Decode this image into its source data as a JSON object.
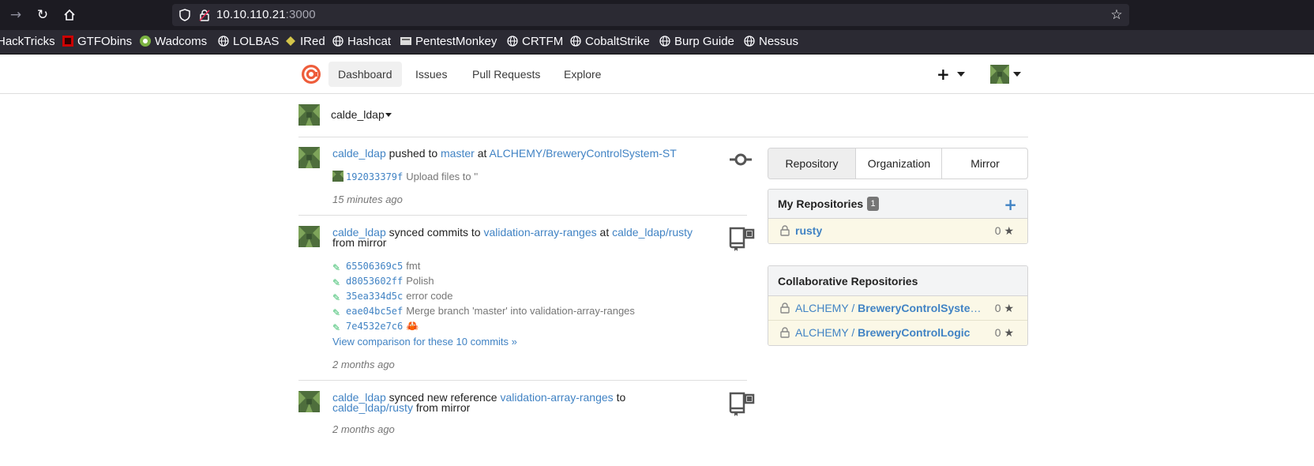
{
  "browser": {
    "url_host": "10.10.110.21",
    "url_port": ":3000",
    "bookmarks": [
      "HackTricks",
      "GTFObins",
      "Wadcoms",
      "LOLBAS",
      "IRed",
      "Hashcat",
      "PentestMonkey",
      "CRTFM",
      "CobaltStrike",
      "Burp Guide",
      "Nessus"
    ]
  },
  "navbar": {
    "items": [
      "Dashboard",
      "Issues",
      "Pull Requests",
      "Explore"
    ],
    "active": "Dashboard",
    "create_icon": "plus-icon",
    "brand_color": "#ee5d3b"
  },
  "context": {
    "user": "calde_ldap"
  },
  "feed": [
    {
      "user": "calde_ldap",
      "action": "pushed to",
      "ref": "master",
      "connector": "at",
      "repo": "ALCHEMY/BreweryControlSystem-ST",
      "suffix": "",
      "icon": "commit-icon",
      "commits": [
        {
          "sha": "192033379f",
          "message": "Upload files to ''"
        }
      ],
      "compare": "",
      "time": "15 minutes ago"
    },
    {
      "user": "calde_ldap",
      "action": "synced commits to",
      "ref": "validation-array-ranges",
      "connector": "at",
      "repo": "calde_ldap/rusty",
      "suffix": "from mirror",
      "icon": "mirror-repo-icon",
      "commits": [
        {
          "sha": "65506369c5",
          "message": "fmt"
        },
        {
          "sha": "d8053602ff",
          "message": "Polish"
        },
        {
          "sha": "35ea334d5c",
          "message": "error code"
        },
        {
          "sha": "eae04bc5ef",
          "message": "Merge branch 'master' into validation-array-ranges"
        },
        {
          "sha": "7e4532e7c6",
          "message": "🦀"
        }
      ],
      "compare": "View comparison for these 10 commits »",
      "time": "2 months ago"
    },
    {
      "user": "calde_ldap",
      "action": "synced new reference",
      "ref": "validation-array-ranges",
      "connector": "to",
      "repo": "calde_ldap/rusty",
      "suffix": "from mirror",
      "icon": "mirror-repo-icon",
      "commits": [],
      "compare": "",
      "time": "2 months ago"
    }
  ],
  "sidebar": {
    "tabs": [
      "Repository",
      "Organization",
      "Mirror"
    ],
    "active_tab": "Repository",
    "my_repos": {
      "title": "My Repositories",
      "count": "1",
      "items": [
        {
          "owner": "",
          "name": "rusty",
          "stars": "0"
        }
      ]
    },
    "collab_repos": {
      "title": "Collaborative Repositories",
      "items": [
        {
          "owner": "ALCHEMY / ",
          "name": "BreweryControlSystem-ST",
          "stars": "0"
        },
        {
          "owner": "ALCHEMY / ",
          "name": "BreweryControlLogic",
          "stars": "0"
        }
      ]
    }
  }
}
